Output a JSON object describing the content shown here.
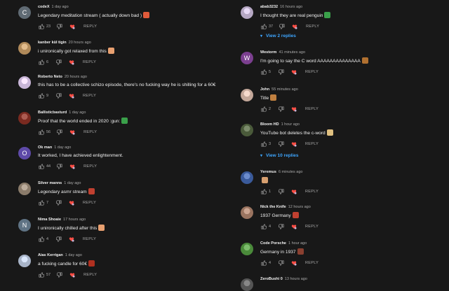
{
  "left_comments": [
    {
      "author": "codeX",
      "time": "1 day ago",
      "text": "Legendary meditation stream (  actually down bad )",
      "likes": "23",
      "avatar": {
        "kind": "letter",
        "letter": "C",
        "color": "#606b74"
      }
    },
    {
      "author": "kanber kül tigin",
      "time": "20 hours ago",
      "text": "i unironically got relaxed from this",
      "likes": "6",
      "avatar": {
        "kind": "photo",
        "color": "#b08a5a"
      }
    },
    {
      "author": "Roberto Neto",
      "time": "20 hours ago",
      "text": "this has to be a collective schizo episode, there's no fucking way he is shilling for a 60€",
      "likes": "9",
      "avatar": {
        "kind": "photo",
        "color": "#c9b6d8"
      }
    },
    {
      "author": "Ballisticbasturd",
      "time": "1 day ago",
      "text": "Proof that the world ended in 2020  :gun:",
      "likes": "56",
      "avatar": {
        "kind": "photo",
        "color": "#7a2a20"
      }
    },
    {
      "author": "Ok man",
      "time": "1 day ago",
      "text": "It worked, I have achieved enlightenment.",
      "likes": "44",
      "avatar": {
        "kind": "letter",
        "letter": "O",
        "color": "#5e4aa8"
      }
    },
    {
      "author": "Silver manns",
      "time": "1 day ago",
      "text": "Legendary asmr stream",
      "likes": "7",
      "avatar": {
        "kind": "photo",
        "color": "#8a7b6a"
      }
    },
    {
      "author": "Nima Shoaie",
      "time": "17 hours ago",
      "text": "I unironically chilled after this",
      "likes": "4",
      "avatar": {
        "kind": "letter",
        "letter": "N",
        "color": "#5f7384"
      }
    },
    {
      "author": "Aias Kerrigan",
      "time": "1 day ago",
      "text": "a fucking candle for 60€",
      "likes": "57",
      "avatar": {
        "kind": "photo",
        "color": "#a8b4c8"
      }
    }
  ],
  "right_comments": [
    {
      "author": "abab3232",
      "time": "16 hours ago",
      "text": "I thought they are real penguin",
      "likes": "37",
      "avatar": {
        "kind": "photo",
        "color": "#b6a8c4"
      }
    },
    {
      "author": "Westorm",
      "time": "41 minutes ago",
      "text": "I'm going to say the C word   AAAAAAAAAAAAAA",
      "likes": "5",
      "avatar": {
        "kind": "letter",
        "letter": "W",
        "color": "#7b3f8f"
      }
    },
    {
      "author": "John",
      "time": "55 minutes ago",
      "text": "Title",
      "likes": "2",
      "avatar": {
        "kind": "photo",
        "color": "#c4a89a"
      }
    },
    {
      "author": "Bloom HD",
      "time": "1 hour ago",
      "text": "YouTube bot deletes the c-word",
      "likes": "3",
      "avatar": {
        "kind": "photo",
        "color": "#4a5a3a"
      }
    },
    {
      "author": "Yeremus",
      "time": "6 minutes ago",
      "text": "",
      "likes": "1",
      "avatar": {
        "kind": "photo",
        "color": "#3a5a9a"
      }
    },
    {
      "author": "Nick the Knife",
      "time": "12 hours ago",
      "text": "1937 Germany",
      "likes": "4",
      "avatar": {
        "kind": "photo",
        "color": "#9a7460"
      }
    },
    {
      "author": "Code Porsche",
      "time": "1 hour ago",
      "text": "Germany in 1937",
      "likes": "4",
      "avatar": {
        "kind": "photo",
        "color": "#4a8a3a"
      }
    },
    {
      "author": "ZeroBushi 0",
      "time": "13 hours ago",
      "text": "",
      "likes": "",
      "avatar": {
        "kind": "photo",
        "color": "#555555"
      }
    }
  ],
  "view_replies": [
    {
      "label": "View 2 replies"
    },
    {
      "label": "View 10 replies"
    }
  ],
  "reply_label": "REPLY",
  "colors": {
    "link": "#3ea6ff",
    "muted": "#aaaaaa",
    "background": "#181818"
  }
}
